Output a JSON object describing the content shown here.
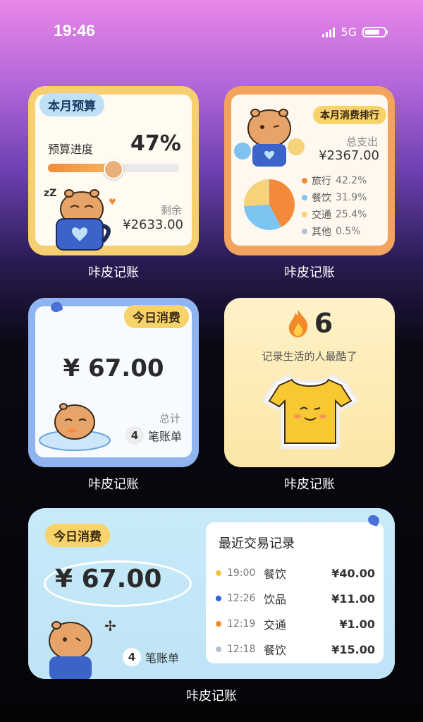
{
  "status": {
    "time": "19:46",
    "network": "5G"
  },
  "w1": {
    "tag": "本月预算",
    "progress_label": "预算进度",
    "percent": "47%",
    "progress_value": 0.47,
    "remain_label": "剩余",
    "remain": "¥2633.00",
    "app": "咔皮记账"
  },
  "w2": {
    "tag": "本月消费排行",
    "total_label": "总支出",
    "total": "¥2367.00",
    "legend": [
      {
        "name": "旅行",
        "value": "42.2%",
        "color": "#f28a3a"
      },
      {
        "name": "餐饮",
        "value": "31.9%",
        "color": "#7cc4f2"
      },
      {
        "name": "交通",
        "value": "25.4%",
        "color": "#f6d27a"
      },
      {
        "name": "其他",
        "value": "0.5%",
        "color": "#b7bfd6"
      }
    ],
    "app": "咔皮记账"
  },
  "w3": {
    "tag": "今日消费",
    "amount": "¥ 67.00",
    "total_label": "总计",
    "count": "4",
    "count_unit": "笔账单",
    "app": "咔皮记账"
  },
  "w4": {
    "streak": "6",
    "slogan": "记录生活的人最酷了",
    "app": "咔皮记账"
  },
  "w5": {
    "tag": "今日消费",
    "amount": "¥ 67.00",
    "count": "4",
    "count_unit": "笔账单",
    "recent_title": "最近交易记录",
    "rows": [
      {
        "time": "19:00",
        "cat": "餐饮",
        "amount": "¥40.00",
        "color": "#f3c640"
      },
      {
        "time": "12:26",
        "cat": "饮品",
        "amount": "¥11.00",
        "color": "#2c63d6"
      },
      {
        "time": "12:19",
        "cat": "交通",
        "amount": "¥1.00",
        "color": "#f08a2c"
      },
      {
        "time": "12:18",
        "cat": "餐饮",
        "amount": "¥15.00",
        "color": "#b8bfd0"
      }
    ],
    "app": "咔皮记账"
  }
}
